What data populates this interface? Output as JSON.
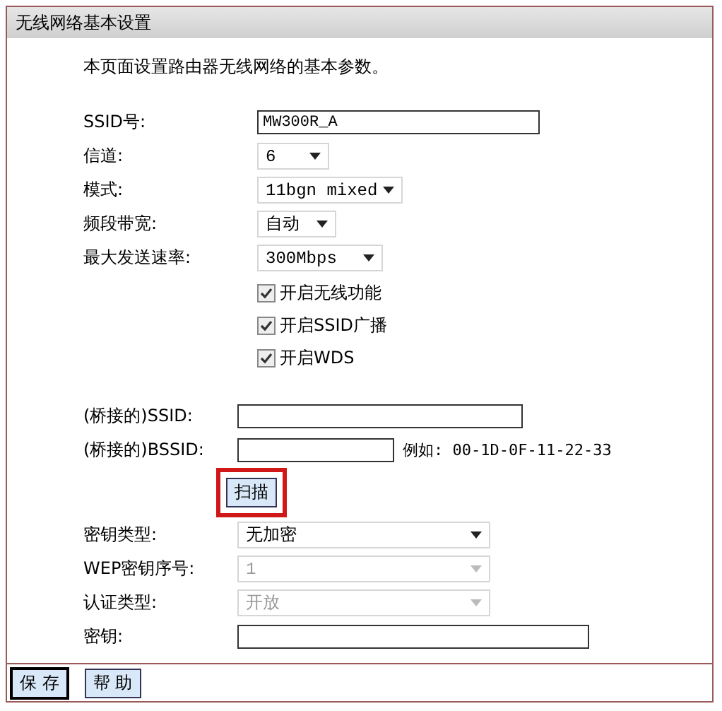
{
  "panel": {
    "title": "无线网络基本设置",
    "description": "本页面设置路由器无线网络的基本参数。"
  },
  "basic_fields": [
    {
      "kind": "text",
      "label": "SSID号:",
      "value": "MW300R_A"
    },
    {
      "kind": "select",
      "label": "信道:",
      "value": "6",
      "disabled": false
    },
    {
      "kind": "select",
      "label": "模式:",
      "value": "11bgn mixed",
      "disabled": false
    },
    {
      "kind": "select",
      "label": "频段带宽:",
      "value": "自动",
      "disabled": false
    },
    {
      "kind": "select",
      "label": "最大发送速率:",
      "value": "300Mbps",
      "disabled": false
    }
  ],
  "checkboxes": [
    {
      "label": "开启无线功能",
      "checked": true
    },
    {
      "label": "开启SSID广播",
      "checked": true
    },
    {
      "label": "开启WDS",
      "checked": true
    }
  ],
  "bridge_fields": [
    {
      "kind": "text",
      "label": "(桥接的)SSID:"
    },
    {
      "kind": "text",
      "label": "(桥接的)BSSID:",
      "hint": "例如: 00-1D-0F-11-22-33"
    }
  ],
  "scan_button": {
    "label": "扫描",
    "highlighted": true
  },
  "security_fields": [
    {
      "kind": "select",
      "label": "密钥类型:",
      "value": "无加密",
      "disabled": false
    },
    {
      "kind": "select",
      "label": "WEP密钥序号:",
      "value": "1",
      "disabled": true
    },
    {
      "kind": "select",
      "label": "认证类型:",
      "value": "开放",
      "disabled": true
    },
    {
      "kind": "text",
      "label": "密钥:"
    }
  ],
  "buttons": [
    {
      "label": "保 存",
      "focused": true
    },
    {
      "label": "帮 助",
      "focused": false
    }
  ]
}
